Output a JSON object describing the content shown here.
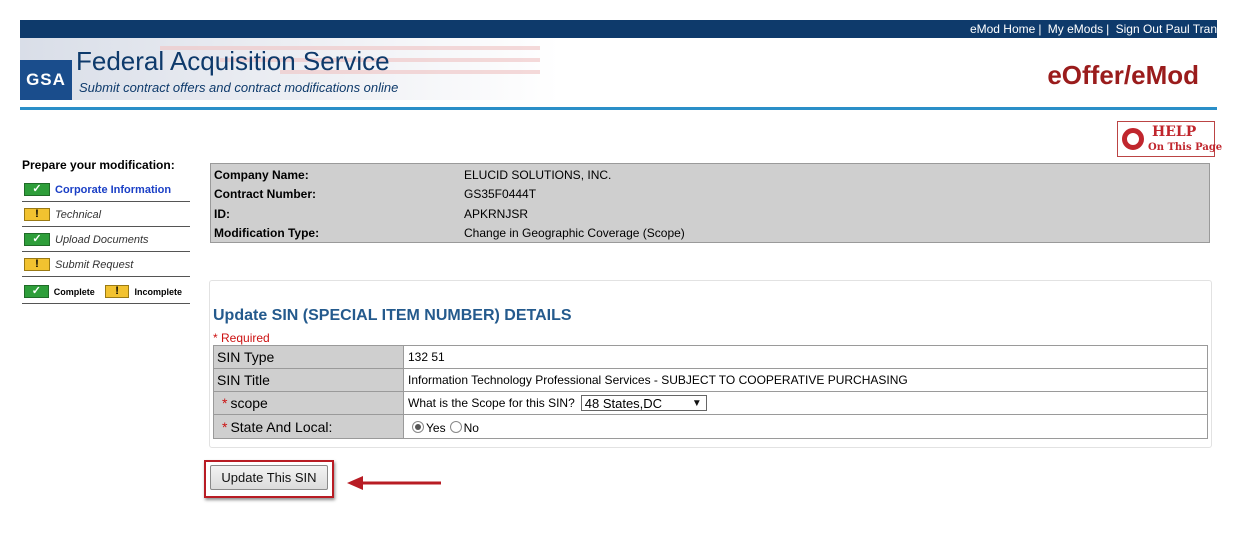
{
  "header": {
    "links": [
      "eMod Home",
      "My eMods",
      "Sign Out Paul Tran"
    ],
    "logo_text": "GSA",
    "title": "Federal Acquisition Service",
    "subtitle": "Submit contract offers and contract modifications online",
    "app_name": "eOffer/eMod",
    "help": {
      "main": "HELP",
      "sub": "On This Page"
    }
  },
  "sidebar": {
    "title": "Prepare your modification:",
    "items": [
      {
        "label": "Corporate Information",
        "status": "complete",
        "active": true
      },
      {
        "label": "Technical",
        "status": "incomplete",
        "active": false
      },
      {
        "label": "Upload Documents",
        "status": "complete",
        "active": false
      },
      {
        "label": "Submit Request",
        "status": "incomplete",
        "active": false
      }
    ],
    "legend": {
      "complete": "Complete",
      "incomplete": "Incomplete"
    }
  },
  "contract_info": [
    {
      "label": "Company Name:",
      "value": "ELUCID SOLUTIONS, INC."
    },
    {
      "label": "Contract Number:",
      "value": "GS35F0444T"
    },
    {
      "label": "ID:",
      "value": "APKRNJSR"
    },
    {
      "label": "Modification Type:",
      "value": "Change in Geographic Coverage (Scope)"
    }
  ],
  "sin_panel": {
    "title": "Update SIN (SPECIAL ITEM NUMBER) DETAILS",
    "required_note": "* Required",
    "rows": {
      "sin_type": {
        "label": "SIN Type",
        "value": "132 51"
      },
      "sin_title": {
        "label": "SIN Title",
        "value": "Information Technology Professional Services - SUBJECT TO COOPERATIVE PURCHASING"
      },
      "scope": {
        "label": "scope",
        "question": "What is the Scope for this SIN?",
        "selected": "48 States,DC"
      },
      "state_local": {
        "label": "State And Local:",
        "yes": "Yes",
        "no": "No",
        "selected": "Yes"
      }
    },
    "required_star": "*"
  },
  "actions": {
    "update_label": "Update This SIN"
  },
  "colors": {
    "brand_navy": "#0e3a6b",
    "app_red": "#9a1c1c",
    "accent_blue": "#2a8fc8",
    "highlight_red": "#b81c24"
  }
}
